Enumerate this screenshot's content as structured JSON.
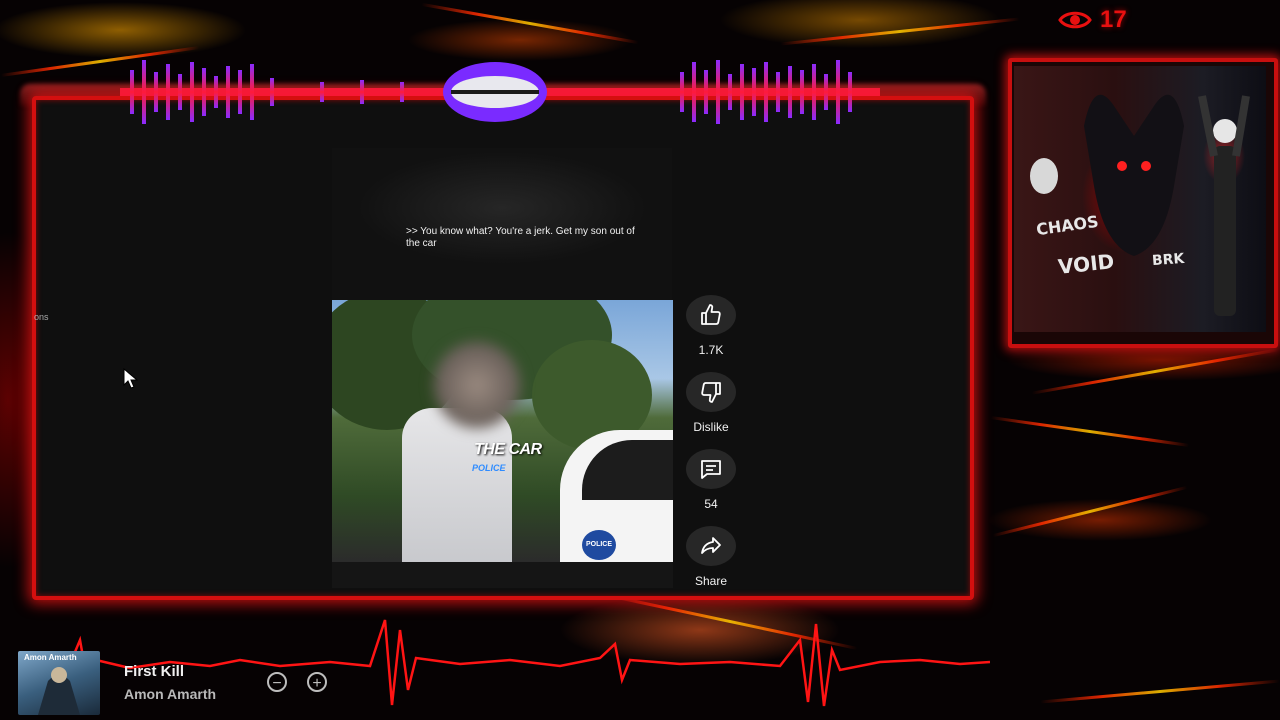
{
  "overlay": {
    "view_count": "17",
    "accent": "#e81010"
  },
  "video": {
    "caption": ">> You know what? You're a jerk. Get my son out of the car",
    "overlay_title": "THE CAR",
    "overlay_subtitle": "POLICE",
    "badge_text": "POLICE"
  },
  "actions": {
    "like_count": "1.7K",
    "dislike_label": "Dislike",
    "comment_count": "54",
    "share_label": "Share"
  },
  "sidebar": {
    "truncated_text": "ons"
  },
  "thumbnail": {
    "tags": [
      "CHAOS",
      "VOID",
      "BRK"
    ]
  },
  "player": {
    "album_label": "Amon Amarth",
    "track_title": "First Kill",
    "artist": "Amon Amarth"
  }
}
